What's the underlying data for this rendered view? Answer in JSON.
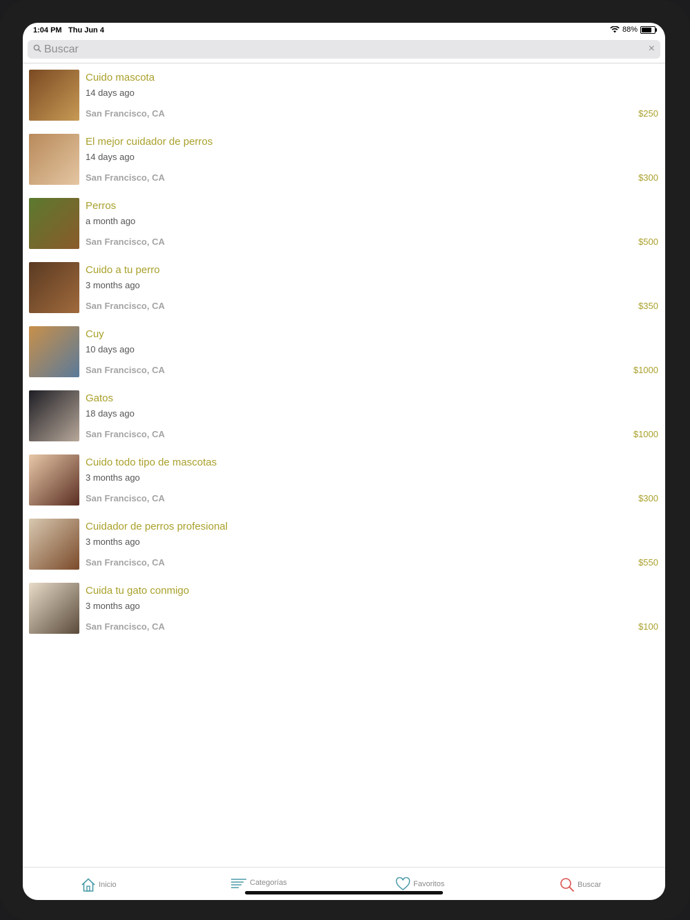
{
  "status": {
    "time": "1:04 PM",
    "date": "Thu Jun 4",
    "battery": "88%",
    "battery_level": 0.88
  },
  "search": {
    "placeholder": "Buscar",
    "clear": "×"
  },
  "listings": [
    {
      "title": "Cuido mascota",
      "ago": "14 days ago",
      "location": "San Francisco, CA",
      "price": "$250",
      "thumb": [
        "#7a4a22",
        "#c79a55"
      ]
    },
    {
      "title": "El mejor cuidador de perros",
      "ago": "14 days ago",
      "location": "San Francisco, CA",
      "price": "$300",
      "thumb": [
        "#b88a5a",
        "#e4c6a2"
      ]
    },
    {
      "title": "Perros",
      "ago": "a month ago",
      "location": "San Francisco, CA",
      "price": "$500",
      "thumb": [
        "#5b7a2f",
        "#8a5a2a"
      ]
    },
    {
      "title": "Cuido a tu perro",
      "ago": "3 months ago",
      "location": "San Francisco, CA",
      "price": "$350",
      "thumb": [
        "#5a3a22",
        "#a06a3c"
      ]
    },
    {
      "title": "Cuy",
      "ago": "10 days ago",
      "location": "San Francisco, CA",
      "price": "$1000",
      "thumb": [
        "#c8904a",
        "#5a7a9a"
      ]
    },
    {
      "title": "Gatos",
      "ago": "18 days ago",
      "location": "San Francisco, CA",
      "price": "$1000",
      "thumb": [
        "#1e1e24",
        "#b8a89a"
      ]
    },
    {
      "title": "Cuido todo tipo de mascotas",
      "ago": "3 months ago",
      "location": "San Francisco, CA",
      "price": "$300",
      "thumb": [
        "#e8c8a8",
        "#5a2e22"
      ]
    },
    {
      "title": "Cuidador de perros profesional",
      "ago": "3 months ago",
      "location": "San Francisco, CA",
      "price": "$550",
      "thumb": [
        "#d8c8b0",
        "#7a4a2a"
      ]
    },
    {
      "title": "Cuida tu gato conmigo",
      "ago": "3 months ago",
      "location": "San Francisco, CA",
      "price": "$100",
      "thumb": [
        "#e8dcc8",
        "#5a4a3a"
      ]
    }
  ],
  "tabs": [
    {
      "label": "Inicio",
      "icon": "home-icon",
      "color": "#4a9aa8"
    },
    {
      "label": "Categorías",
      "icon": "list-icon",
      "color": "#4a9aa8"
    },
    {
      "label": "Favoritos",
      "icon": "heart-icon",
      "color": "#4a9aa8"
    },
    {
      "label": "Buscar",
      "icon": "search-icon",
      "color": "#d9534f"
    }
  ]
}
